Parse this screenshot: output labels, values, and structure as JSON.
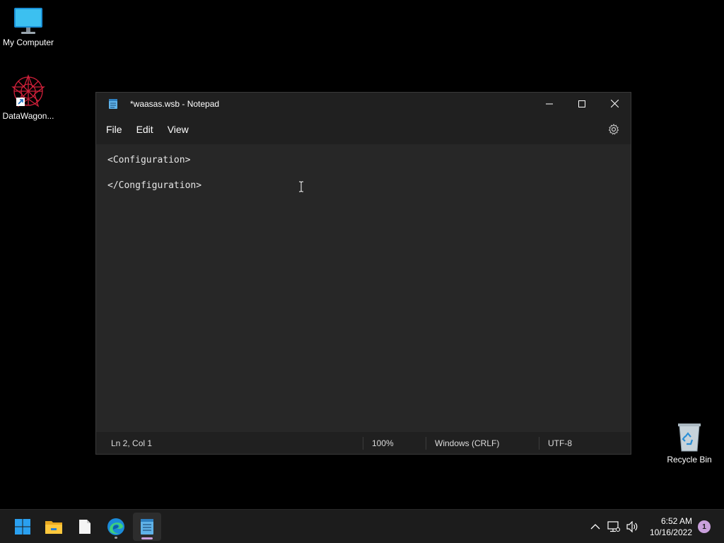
{
  "desktop": {
    "icons": [
      {
        "label": "My Computer",
        "icon": "monitor-icon"
      },
      {
        "label": "DataWagon...",
        "icon": "datawagon-icon"
      },
      {
        "label": "Recycle Bin",
        "icon": "recycle-bin-icon"
      }
    ]
  },
  "window": {
    "title": "*waasas.wsb - Notepad",
    "app_icon": "notepad-icon",
    "controls": {
      "minimize": "minimize-icon",
      "maximize": "maximize-icon",
      "close": "close-icon"
    }
  },
  "menubar": {
    "items": [
      {
        "label": "File"
      },
      {
        "label": "Edit"
      },
      {
        "label": "View"
      }
    ],
    "settings_icon": "gear-icon"
  },
  "editor": {
    "lines": [
      "<Configuration>",
      "",
      "</Congfiguration>"
    ]
  },
  "statusbar": {
    "position": "Ln 2, Col 1",
    "zoom": "100%",
    "line_ending": "Windows (CRLF)",
    "encoding": "UTF-8"
  },
  "taskbar": {
    "apps": [
      "start-icon",
      "file-explorer-icon",
      "file-icon",
      "edge-icon",
      "notepad-icon"
    ],
    "clock": {
      "time": "6:52 AM",
      "date": "10/16/2022"
    },
    "notifications": "1"
  },
  "colors": {
    "window_bg": "#272727",
    "chrome_bg": "#202020",
    "accent": "#c9a0dc",
    "desktop_bg": "#000000"
  }
}
